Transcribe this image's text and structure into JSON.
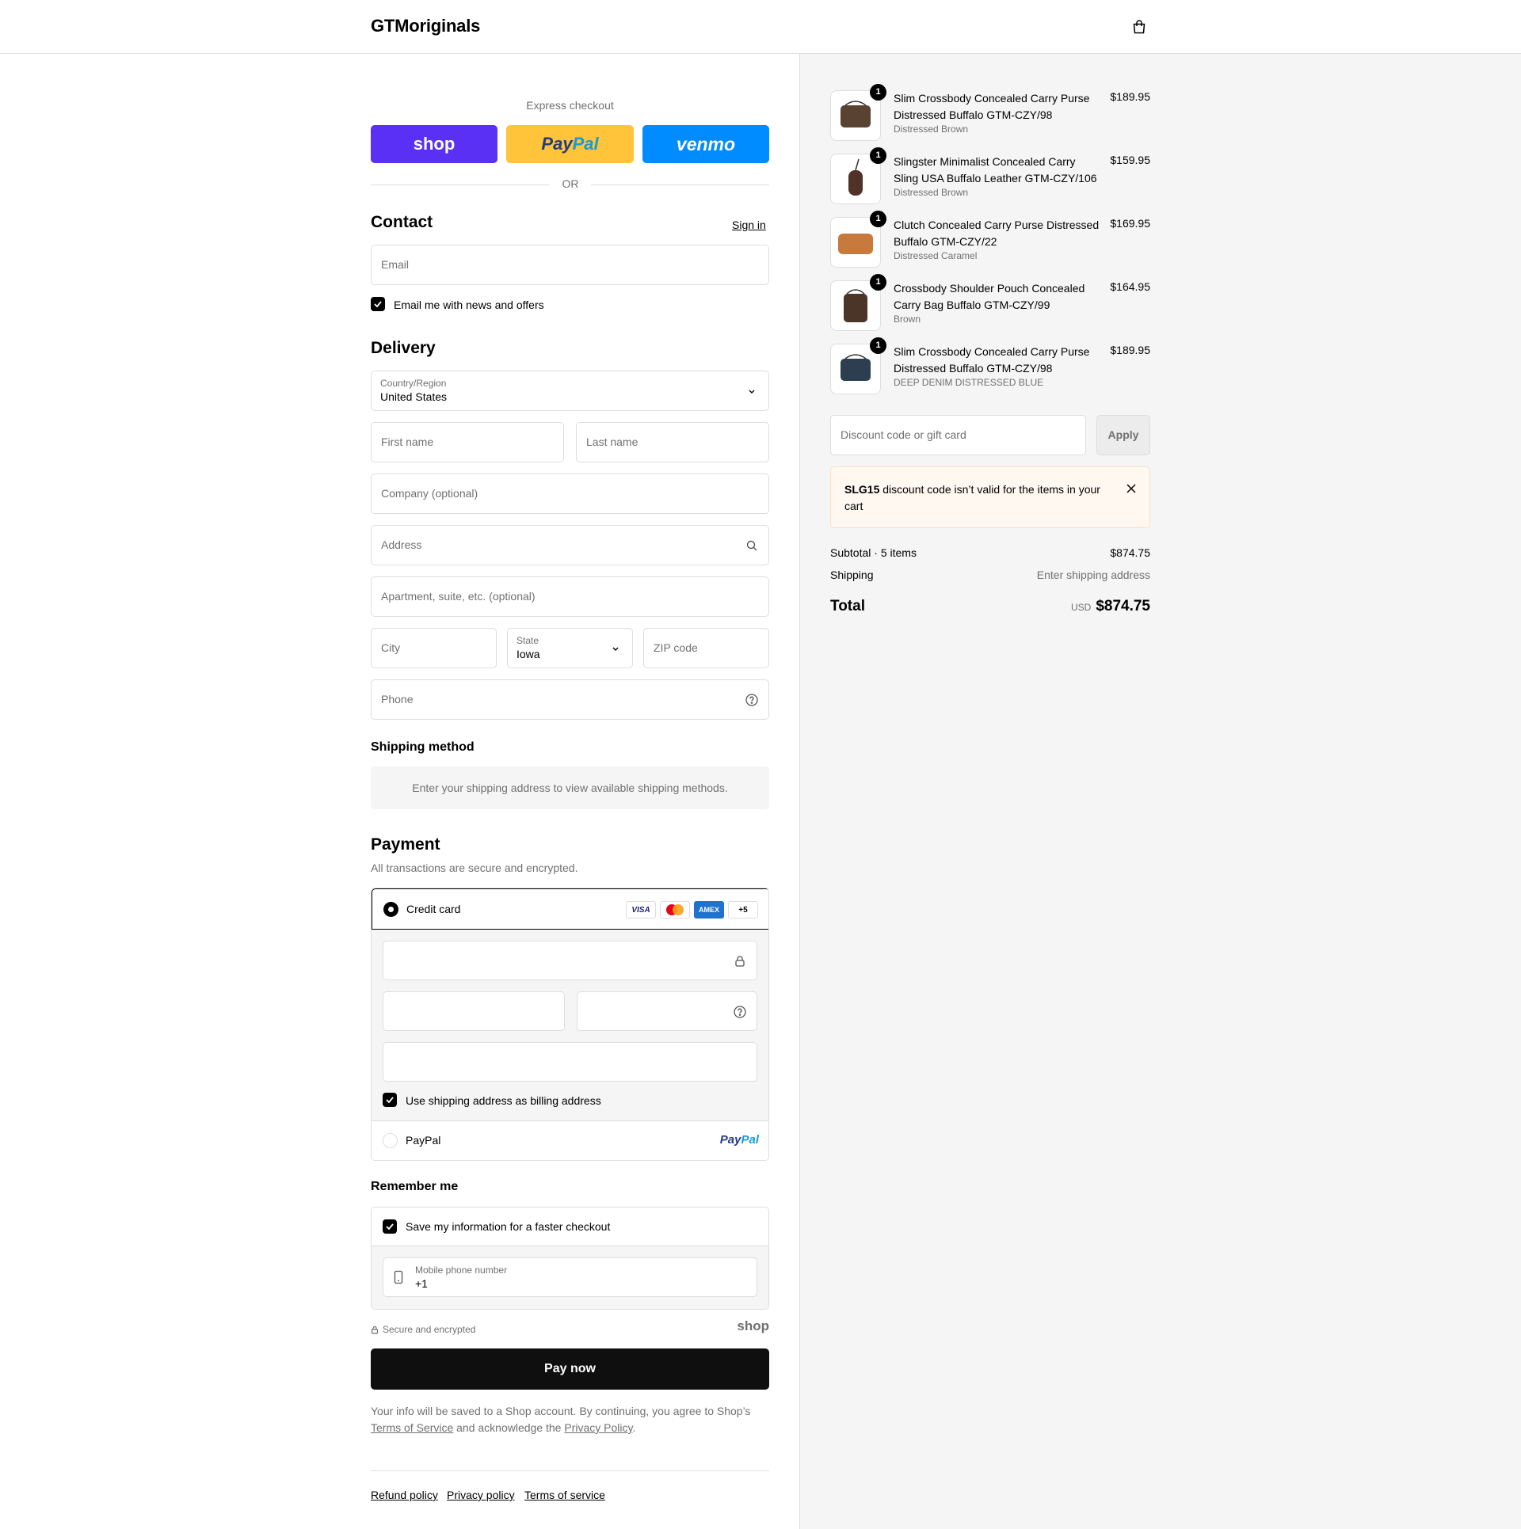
{
  "header": {
    "logo": "GTMoriginals"
  },
  "express": {
    "title": "Express checkout",
    "shop": "shop",
    "paypal_a": "Pay",
    "paypal_b": "Pal",
    "venmo": "venmo",
    "or": "OR"
  },
  "contact": {
    "title": "Contact",
    "sign_in": "Sign in",
    "email_placeholder": "Email",
    "news_label": "Email me with news and offers"
  },
  "delivery": {
    "title": "Delivery",
    "country_label": "Country/Region",
    "country_value": "United States",
    "first_name": "First name",
    "last_name": "Last name",
    "company": "Company (optional)",
    "address": "Address",
    "apartment": "Apartment, suite, etc. (optional)",
    "city": "City",
    "state_label": "State",
    "state_value": "Iowa",
    "zip": "ZIP code",
    "phone": "Phone"
  },
  "shipping": {
    "title": "Shipping method",
    "message": "Enter your shipping address to view available shipping methods."
  },
  "payment": {
    "title": "Payment",
    "subtitle": "All transactions are secure and encrypted.",
    "credit_card": "Credit card",
    "cards": [
      "VISA",
      "",
      "AMEX",
      "+5"
    ],
    "billing_label": "Use shipping address as billing address",
    "paypal_label": "PayPal",
    "paypal_logo_a": "Pay",
    "paypal_logo_b": "Pal"
  },
  "remember": {
    "title": "Remember me",
    "save_label": "Save my information for a faster checkout",
    "mobile_label": "Mobile phone number",
    "mobile_value": "+1",
    "secure": "Secure and encrypted",
    "shop": "shop"
  },
  "pay_now": "Pay now",
  "fine_print": {
    "text_1": "Your info will be saved to a Shop account. By continuing, you agree to Shop’s ",
    "terms": "Terms of Service",
    "text_2": " and acknowledge the ",
    "privacy": "Privacy Policy",
    "text_3": "."
  },
  "footer_links": [
    "Refund policy",
    "Privacy policy",
    "Terms of service"
  ],
  "order": {
    "items": [
      {
        "name": "Slim Crossbody Concealed Carry Purse Distressed Buffalo GTM-CZY/98",
        "variant": "Distressed Brown",
        "price": "$189.95",
        "qty": "1",
        "color": "#5a4232"
      },
      {
        "name": "Slingster Minimalist Concealed Carry Sling USA Buffalo Leather GTM-CZY/106",
        "variant": "Distressed Brown",
        "price": "$159.95",
        "qty": "1",
        "color": "#4e3326"
      },
      {
        "name": "Clutch Concealed Carry Purse Distressed Buffalo GTM-CZY/22",
        "variant": "Distressed Caramel",
        "price": "$169.95",
        "qty": "1",
        "color": "#c77a3c"
      },
      {
        "name": "Crossbody Shoulder Pouch Concealed Carry Bag Buffalo GTM-CZY/99",
        "variant": "Brown",
        "price": "$164.95",
        "qty": "1",
        "color": "#4a3528"
      },
      {
        "name": "Slim Crossbody Concealed Carry Purse Distressed Buffalo GTM-CZY/98",
        "variant": "DEEP DENIM DISTRESSED BLUE",
        "price": "$189.95",
        "qty": "1",
        "color": "#2c3e50"
      }
    ],
    "discount_placeholder": "Discount code or gift card",
    "apply": "Apply",
    "alert_code": "SLG15",
    "alert_text": " discount code isn’t valid for the items in your cart",
    "subtotal_label": "Subtotal · 5 items",
    "subtotal_value": "$874.75",
    "shipping_label": "Shipping",
    "shipping_value": "Enter shipping address",
    "total_label": "Total",
    "currency": "USD",
    "total_value": "$874.75"
  },
  "colors": {
    "shop": "#5a31f4",
    "paypal": "#ffc439",
    "venmo": "#008cff",
    "button": "#0f0f0f",
    "panel": "#f5f5f5"
  }
}
